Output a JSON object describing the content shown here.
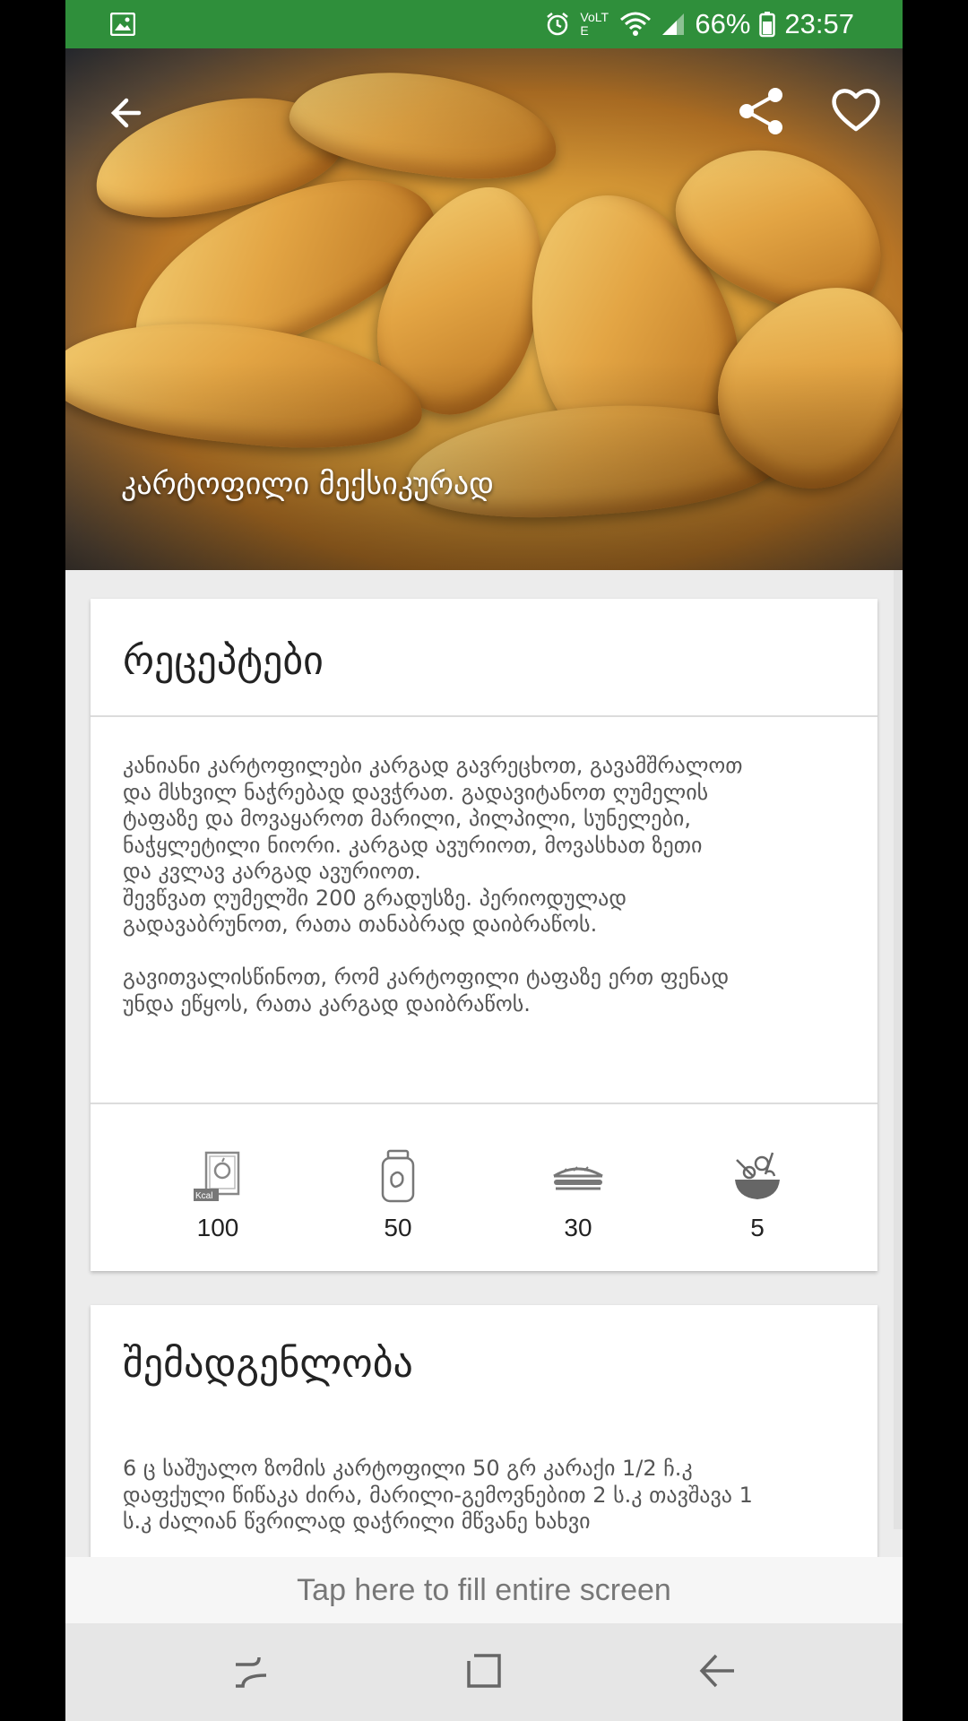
{
  "status_bar": {
    "battery_percent": "66%",
    "time": "23:57",
    "network_label": "VoLTE"
  },
  "hero": {
    "title": "კარტოფილი მექსიკურად"
  },
  "recipe_card": {
    "title": "რეცეპტები",
    "instructions": "კანიანი კარტოფილები კარგად გავრეცხოთ, გავამშრალოთ\nდა მსხვილ ნაჭრებად დავჭრათ. გადავიტანოთ ღუმელის\nტაფაზე და მოვაყაროთ მარილი, პილპილი, სუნელები,\nნაჭყლეტილი ნიორი. კარგად ავურიოთ, მოვასხათ ზეთი\nდა კვლავ კარგად ავურიოთ.\nშევწვათ ღუმელში 200 გრადუსზე. პერიოდულად\nგადავაბრუნოთ, რათა თანაბრად დაიბრაწოს.\n\nგავითვალისწინოთ, რომ კარტოფილი ტაფაზე ერთ ფენად\nუნდა ეწყოს, რათა კარგად დაიბრაწოს.",
    "stats": [
      {
        "icon": "kcal-book-icon",
        "value": "100",
        "icon_badge": "Kcal"
      },
      {
        "icon": "jar-icon",
        "value": "50"
      },
      {
        "icon": "bread-icon",
        "value": "30"
      },
      {
        "icon": "salad-bowl-icon",
        "value": "5"
      }
    ]
  },
  "ingredients_card": {
    "title": "შემადგენლობა",
    "text": "6 ც საშუალო ზომის კარტოფილი 50 გრ კარაქი 1/2 ჩ.კ\nდაფქული წიწაკა ძირა, მარილი-გემოვნებით 2 ს.კ თავშავა 1\nს.კ ძალიან წვრილად დაჭრილი მწვანე ხახვი"
  },
  "ad_banner": {
    "label": "Tap here to fill entire screen"
  },
  "colors": {
    "status_bar": "#2f8f3b",
    "background": "#ececec",
    "card": "#ffffff"
  }
}
